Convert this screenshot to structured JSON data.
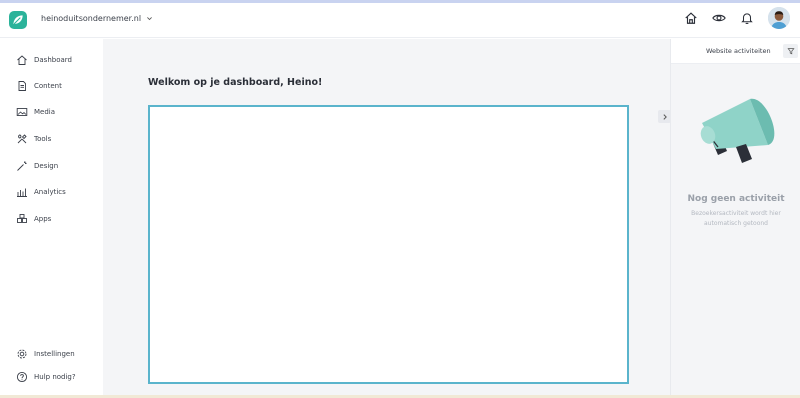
{
  "topbar": {
    "site_name": "heinoduitsondernemer.nl",
    "icons": [
      "home-icon",
      "eye-icon",
      "bell-icon"
    ]
  },
  "sidebar": {
    "items": [
      {
        "label": "Dashboard",
        "icon": "home-icon"
      },
      {
        "label": "Content",
        "icon": "document-icon"
      },
      {
        "label": "Media",
        "icon": "image-icon"
      },
      {
        "label": "Tools",
        "icon": "tools-icon"
      },
      {
        "label": "Design",
        "icon": "magic-wand-icon"
      },
      {
        "label": "Analytics",
        "icon": "bar-chart-icon"
      },
      {
        "label": "Apps",
        "icon": "apps-icon"
      }
    ],
    "bottom_items": [
      {
        "label": "Instellingen",
        "icon": "gear-icon"
      },
      {
        "label": "Hulp nodig?",
        "icon": "help-icon"
      }
    ]
  },
  "main": {
    "welcome": "Welkom op je dashboard, Heino!"
  },
  "activity_panel": {
    "title": "Website activiteiten",
    "empty_title": "Nog geen activiteit",
    "empty_subtitle": "Bezoekersactiviteit wordt hier automatisch getoond"
  },
  "colors": {
    "brand": "#2bb39a",
    "frame_border": "#5ab4cc",
    "megaphone": "#8fd3c8"
  }
}
